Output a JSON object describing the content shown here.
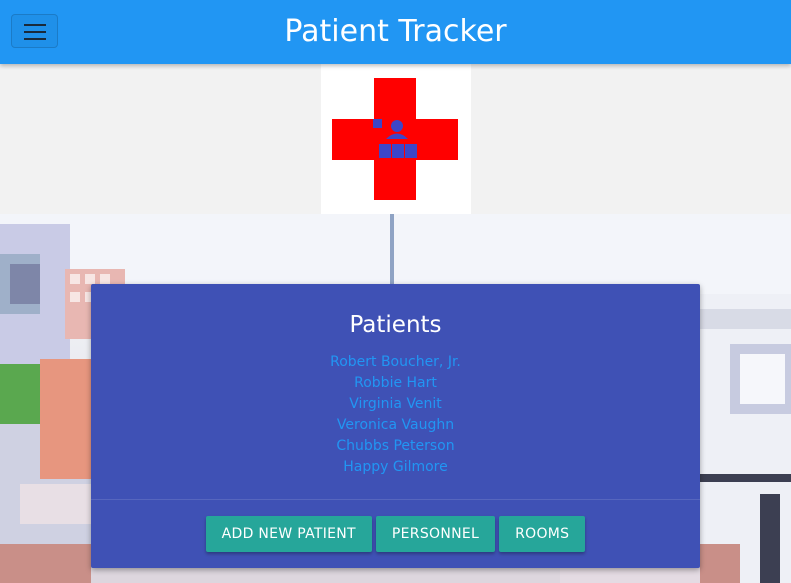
{
  "header": {
    "title": "Patient Tracker",
    "menu_icon": "hamburger-menu-icon",
    "background_color": "#2196f3"
  },
  "logo": {
    "icon": "red-cross-hospital-logo",
    "color": "#ff0000"
  },
  "patients_card": {
    "title": "Patients",
    "patients": [
      "Robert Boucher, Jr.",
      "Robbie Hart",
      "Virginia Venit",
      "Veronica Vaughn",
      "Chubbs Peterson",
      "Happy Gilmore"
    ],
    "buttons": {
      "add_new_patient": "ADD NEW PATIENT",
      "personnel": "PERSONNEL",
      "rooms": "ROOMS"
    },
    "card_color": "#3f51b5",
    "link_color": "#2196f3",
    "button_color": "#26a69a"
  },
  "background": {
    "description_icon": "hospital-building-background"
  }
}
